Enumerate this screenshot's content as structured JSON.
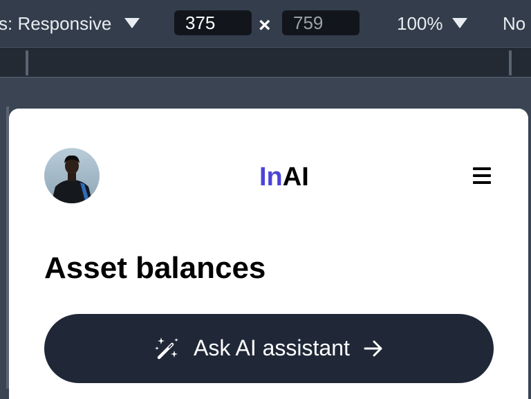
{
  "toolbar": {
    "dimensions_label": "s: Responsive",
    "width_value": "375",
    "height_value": "759",
    "times_symbol": "×",
    "zoom_label": "100%",
    "throttle_label": "No"
  },
  "header": {
    "logo_accent": "In",
    "logo_rest": "AI"
  },
  "main": {
    "title": "Asset balances",
    "ai_button_label": "Ask AI assistant"
  },
  "icons": {
    "dimensions_caret": "caret-down-icon",
    "zoom_caret": "caret-down-icon",
    "menu": "hamburger-menu-icon",
    "ai": "magic-wand-icon",
    "arrow": "arrow-right-icon"
  },
  "colors": {
    "logo_accent": "#4b44d9",
    "button_bg": "#202838",
    "toolbar_bg": "#333d4c"
  }
}
